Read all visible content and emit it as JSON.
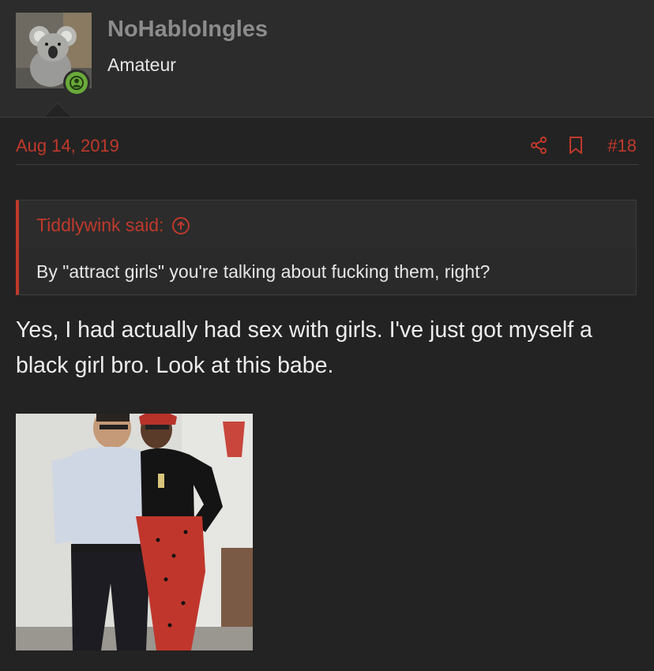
{
  "user": {
    "name": "NoHabloIngles",
    "title": "Amateur"
  },
  "post": {
    "date": "Aug 14, 2019",
    "number": "#18",
    "message": "Yes, I had actually had sex with girls. I've just got myself a black girl bro. Look at this babe."
  },
  "quote": {
    "author": "Tiddlywink said:",
    "text": "By \"attract girls\" you're talking about fucking them, right?"
  },
  "icons": {
    "avatar": "koala-avatar-image",
    "online": "user-online-icon",
    "share": "share-icon",
    "bookmark": "bookmark-icon",
    "quote_jump": "arrow-up-circle-icon"
  },
  "colors": {
    "accent": "#c0392b",
    "online": "#6aaa3a",
    "background": "#232323"
  }
}
